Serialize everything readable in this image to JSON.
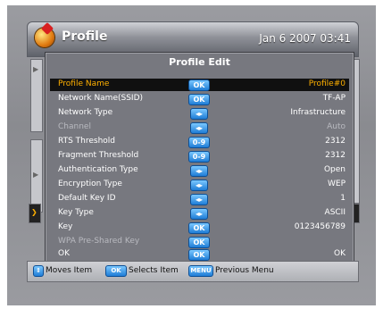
{
  "header": {
    "title": "Profile",
    "datetime": "Jan 6 2007 03:41",
    "logo_icon": "profile-logo-icon"
  },
  "dialog": {
    "title": "Profile Edit"
  },
  "rows": [
    {
      "label": "Profile Name",
      "control": "OK",
      "value": "Profile#0"
    },
    {
      "label": "Network Name(SSID)",
      "control": "OK",
      "value": "TF-AP"
    },
    {
      "label": "Network Type",
      "control": "◂▸",
      "value": "Infrastructure"
    },
    {
      "label": "Channel",
      "control": "◂▸",
      "value": "Auto"
    },
    {
      "label": "RTS Threshold",
      "control": "0-9",
      "value": "2312"
    },
    {
      "label": "Fragment Threshold",
      "control": "0-9",
      "value": "2312"
    },
    {
      "label": "Authentication Type",
      "control": "◂▸",
      "value": "Open"
    },
    {
      "label": "Encryption Type",
      "control": "◂▸",
      "value": "WEP"
    },
    {
      "label": "Default Key ID",
      "control": "◂▸",
      "value": "1"
    },
    {
      "label": "Key Type",
      "control": "◂▸",
      "value": "ASCII"
    },
    {
      "label": "Key",
      "control": "OK",
      "value": "0123456789"
    },
    {
      "label": "WPA Pre-Shared Key",
      "control": "OK",
      "value": ""
    },
    {
      "label": "OK",
      "control": "OK",
      "value": "OK"
    }
  ],
  "footer": {
    "moves_label": "Moves Item",
    "ok_badge": "OK",
    "selects_label": "Selects Item",
    "menu_badge": "MENU",
    "previous_label": "Previous Menu"
  },
  "colors": {
    "selected_text": "#ffb000",
    "button_blue": "#1f7dd6"
  }
}
